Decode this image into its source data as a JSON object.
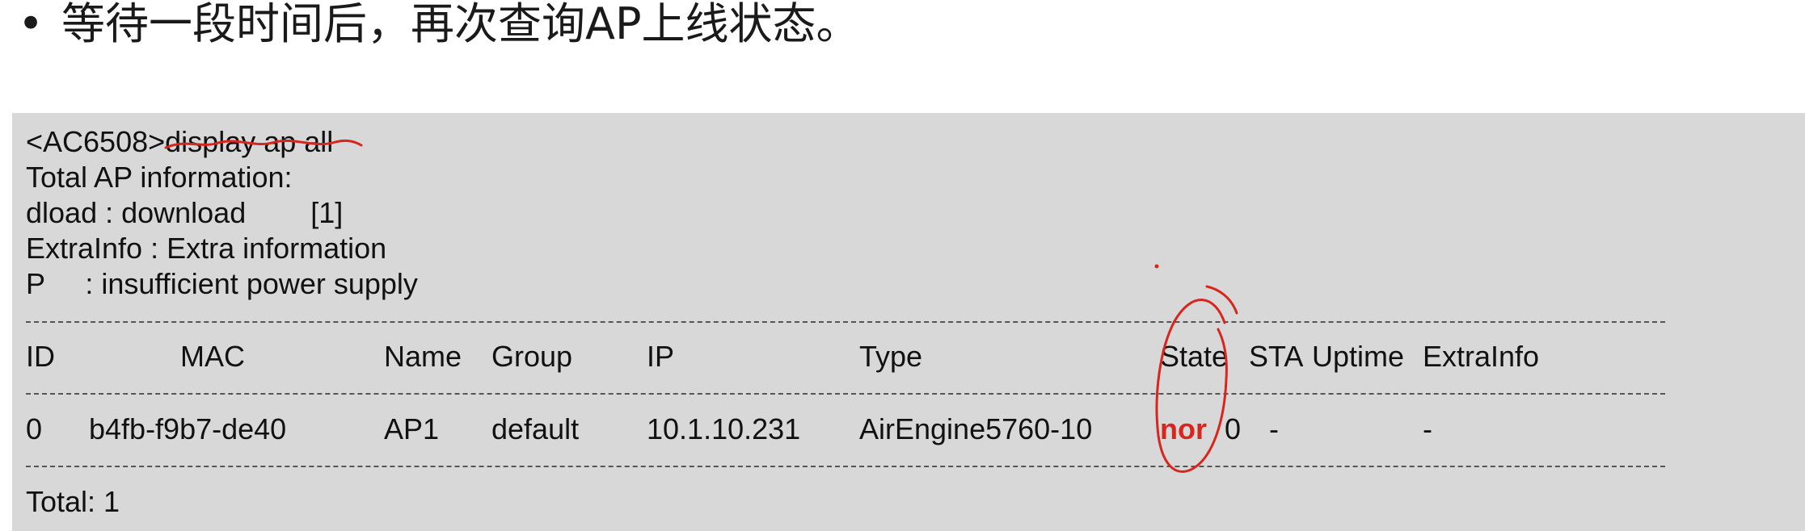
{
  "slide": {
    "bullet": "•",
    "heading": "等待一段时间后，再次查询AP上线状态。"
  },
  "terminal": {
    "prompt": "<AC6508>",
    "command": "display ap all",
    "info_lines": [
      "Total AP information:",
      "dload : download        [1]",
      "ExtraInfo : Extra information",
      "P     : insufficient power supply"
    ],
    "headers": [
      "ID",
      "MAC",
      "Name",
      "Group",
      "IP",
      "Type",
      "State",
      "STA",
      "Uptime",
      "ExtraInfo"
    ],
    "rows": [
      [
        "0",
        "b4fb-f9b7-de40",
        "AP1",
        "default",
        "10.1.10.231",
        "AirEngine5760-10",
        "nor",
        "0",
        "-",
        "-"
      ]
    ],
    "total": "Total: 1"
  },
  "annotation_color": "#d6261d"
}
